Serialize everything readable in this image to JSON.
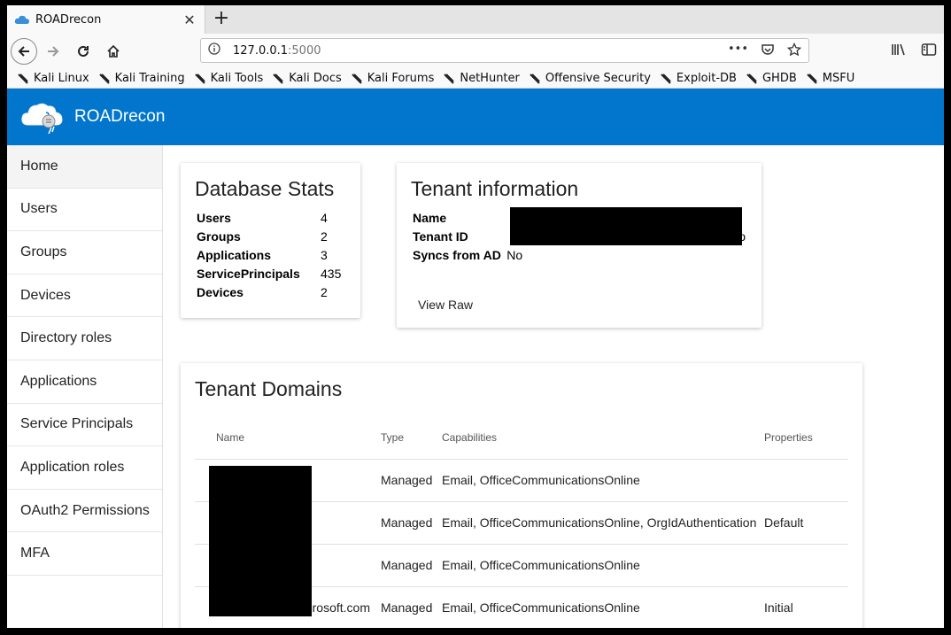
{
  "browser": {
    "tab_title": "ROADrecon",
    "tab_close": "✕",
    "new_tab": "+",
    "url_host": "127.0.0.1",
    "url_port": ":5000",
    "url_more": "•••",
    "bookmarks": [
      {
        "label": "Kali Linux",
        "icon": "kali-dragon-icon"
      },
      {
        "label": "Kali Training",
        "icon": "kali-dragon-icon"
      },
      {
        "label": "Kali Tools",
        "icon": "kali-dragon-icon"
      },
      {
        "label": "Kali Docs",
        "icon": "kali-docs-icon"
      },
      {
        "label": "Kali Forums",
        "icon": "kali-dragon-icon"
      },
      {
        "label": "NetHunter",
        "icon": "nethunter-icon"
      },
      {
        "label": "Offensive Security",
        "icon": "offsec-icon"
      },
      {
        "label": "Exploit-DB",
        "icon": "exploitdb-icon"
      },
      {
        "label": "GHDB",
        "icon": "ghdb-icon"
      },
      {
        "label": "MSFU",
        "icon": "msfu-icon"
      }
    ]
  },
  "app": {
    "title": "ROADrecon",
    "accent": "#0176cc"
  },
  "sidebar": {
    "items": [
      {
        "label": "Home"
      },
      {
        "label": "Users"
      },
      {
        "label": "Groups"
      },
      {
        "label": "Devices"
      },
      {
        "label": "Directory roles"
      },
      {
        "label": "Applications"
      },
      {
        "label": "Service Principals"
      },
      {
        "label": "Application roles"
      },
      {
        "label": "OAuth2 Permissions"
      },
      {
        "label": "MFA"
      }
    ]
  },
  "stats": {
    "title": "Database Stats",
    "rows": [
      {
        "key": "Users",
        "value": "4"
      },
      {
        "key": "Groups",
        "value": "2"
      },
      {
        "key": "Applications",
        "value": "3"
      },
      {
        "key": "ServicePrincipals",
        "value": "435"
      },
      {
        "key": "Devices",
        "value": "2"
      }
    ]
  },
  "tenant": {
    "title": "Tenant information",
    "rows": [
      {
        "key": "Name",
        "value": ""
      },
      {
        "key": "Tenant ID",
        "value": "o"
      },
      {
        "key": "Syncs from AD",
        "value": "No"
      }
    ],
    "view_raw": "View Raw"
  },
  "domains": {
    "title": "Tenant Domains",
    "headers": {
      "name": "Name",
      "type": "Type",
      "capabilities": "Capabilities",
      "properties": "Properties"
    },
    "rows": [
      {
        "name": "",
        "type": "Managed",
        "capabilities": "Email, OfficeCommunicationsOnline",
        "properties": ""
      },
      {
        "name": "",
        "type": "Managed",
        "capabilities": "Email, OfficeCommunicationsOnline, OrgIdAuthentication",
        "properties": "Default"
      },
      {
        "name": "",
        "type": "Managed",
        "capabilities": "Email, OfficeCommunicationsOnline",
        "properties": ""
      },
      {
        "name": "microsoft.com",
        "type": "Managed",
        "capabilities": "Email, OfficeCommunicationsOnline",
        "properties": "Initial"
      }
    ]
  }
}
